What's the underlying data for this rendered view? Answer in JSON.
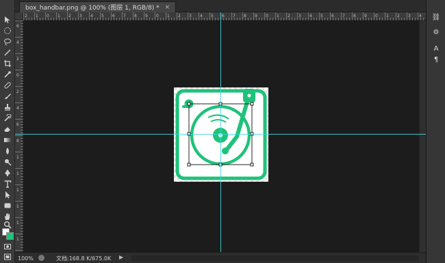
{
  "document": {
    "tab_title": "box_handbar.png @ 100% (图层 1, RGB/8) *",
    "tab_close": "×"
  },
  "status": {
    "zoom": "100%",
    "doc_info": "文档:168.8 K/675.0K",
    "arrow": "▶"
  },
  "ruler_top_labels": [
    "2",
    "1",
    "0",
    "1",
    "2",
    "3",
    "4",
    "5",
    "6",
    "7",
    "8",
    "9",
    "0",
    "1",
    "2",
    "3",
    "4",
    "5",
    "6",
    "7",
    "8",
    "9",
    "0",
    "1",
    "2",
    "3",
    "4",
    "5",
    "6",
    "7",
    "8",
    "9",
    "0",
    "1",
    "2",
    "3",
    "4",
    "5"
  ],
  "ruler_left_labels": [
    "6",
    "4",
    "2",
    "0",
    "2",
    "4",
    "6",
    "8",
    "1",
    "1",
    "1",
    "1",
    "1",
    "1"
  ],
  "right_panel": {
    "buttons": [
      "⛓",
      "⚙",
      "A",
      "¶"
    ]
  },
  "colors": {
    "foreground": "#ffffff",
    "background": "#1fc27a",
    "icon_green": "#1fc27a",
    "guide": "#3fd7dc"
  }
}
